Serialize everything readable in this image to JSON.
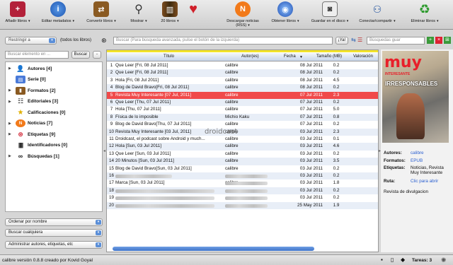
{
  "toolbar": {
    "add_books": "Añadir libros",
    "edit_metadata": "Editar metadatos",
    "convert_books": "Convertir libros",
    "show": "Mostrar",
    "books_count": "20 libros",
    "download_news": "Descargar noticias (RSS)",
    "get_books": "Obtener libros",
    "save_to_disk": "Guardar en el disco",
    "connect_share": "Conectar/compartir",
    "remove_books": "Eliminar libros"
  },
  "search": {
    "restrict_label": "Restringir a",
    "all_books": "(todos los libros)",
    "placeholder": "Buscar (Para búsqueda avanzada, pulse el botón de la izquierda)",
    "go_button": "¡Ya!",
    "saved_searches_placeholder": "Búsquedas guar"
  },
  "tag_browser": {
    "find_placeholder": "Buscar elemento en ...",
    "find_button": "Buscar",
    "collapse_button": "-",
    "items": [
      {
        "label": "Autores [4]",
        "icon": "person-icon"
      },
      {
        "label": "Serie [0]",
        "icon": "series-icon"
      },
      {
        "label": "Formatos [2]",
        "icon": "book-icon"
      },
      {
        "label": "Editoriales [3]",
        "icon": "publisher-icon"
      },
      {
        "label": "Calificaciones [0]",
        "icon": "star-icon"
      },
      {
        "label": "Noticias [7]",
        "icon": "news-icon"
      },
      {
        "label": "Etiquetas [9]",
        "icon": "tag-icon"
      },
      {
        "label": "Identificadores [0]",
        "icon": "barcode-icon"
      },
      {
        "label": "Búsquedas [1]",
        "icon": "binoculars-icon"
      }
    ],
    "sort_by": "Ordenar por nombre",
    "match": "Buscar cualquiera",
    "manage": "Administrar autores, etiquetas, etc"
  },
  "table": {
    "headers": {
      "title": "Título",
      "author": "Autor(es)",
      "date": "Fecha",
      "size": "Tamaño (MB)",
      "rating": "Valoración"
    },
    "rows": [
      {
        "n": "1",
        "title": "Que Leer [Fri, 08 Jul 2011]",
        "author": "calibre",
        "date": "08 Jul 2011",
        "size": "0.2"
      },
      {
        "n": "2",
        "title": "Que Leer [Fri, 08 Jul 2011]",
        "author": "calibre",
        "date": "08 Jul 2011",
        "size": "0.2"
      },
      {
        "n": "3",
        "title": "Hola [Fri, 08 Jul 2011]",
        "author": "calibre",
        "date": "08 Jul 2011",
        "size": "4.5"
      },
      {
        "n": "4",
        "title": "Blog de David Bravo[Fri, 08 Jul 2011]",
        "author": "calibre",
        "date": "08 Jul 2011",
        "size": "0.2"
      },
      {
        "n": "5",
        "title": "Revista Muy Interesante [07 Jul, 2011]",
        "author": "calibre",
        "date": "07 Jul 2011",
        "size": "2.3"
      },
      {
        "n": "6",
        "title": "Que Leer [Thu, 07 Jul 2011]",
        "author": "calibre",
        "date": "07 Jul 2011",
        "size": "0.2"
      },
      {
        "n": "7",
        "title": "Hola [Thu, 07 Jul 2011]",
        "author": "calibre",
        "date": "07 Jul 2011",
        "size": "5.0"
      },
      {
        "n": "8",
        "title": "Física de lo imposible",
        "author": "Michio Kaku",
        "date": "07 Jul 2011",
        "size": "0.8"
      },
      {
        "n": "9",
        "title": "Blog de David Bravo[Thu, 07 Jul 2011]",
        "author": "calibre",
        "date": "07 Jul 2011",
        "size": "0.2"
      },
      {
        "n": "10",
        "title": "Revista Muy Interesante [03 Jul, 2011]",
        "author": "calibre",
        "date": "03 Jul 2011",
        "size": "2.3"
      },
      {
        "n": "11",
        "title": "Droidcast, el podcast sobre Android y much...",
        "author": "calibre",
        "date": "03 Jul 2011",
        "size": "0.1"
      },
      {
        "n": "12",
        "title": "Hola [Sun, 03 Jul 2011]",
        "author": "calibre",
        "date": "03 Jul 2011",
        "size": "4.6"
      },
      {
        "n": "13",
        "title": "Que Leer [Sun, 03 Jul 2011]",
        "author": "calibre",
        "date": "03 Jul 2011",
        "size": "0.2"
      },
      {
        "n": "14",
        "title": "20 Minutos [Sun, 03 Jul 2011]",
        "author": "calibre",
        "date": "03 Jul 2011",
        "size": "3.5"
      },
      {
        "n": "15",
        "title": "Blog de David Bravo[Sun, 03 Jul 2011]",
        "author": "calibre",
        "date": "03 Jul 2011",
        "size": "0.2"
      },
      {
        "n": "16",
        "title": "",
        "author": "",
        "date": "03 Jul 2011",
        "size": "0.2"
      },
      {
        "n": "17",
        "title": "Marca [Sun, 03 Jul 2011]",
        "author": "calibre",
        "date": "03 Jul 2011",
        "size": "1.8"
      },
      {
        "n": "18",
        "title": "",
        "author": "",
        "date": "03 Jul 2011",
        "size": "0.2"
      },
      {
        "n": "19",
        "title": "",
        "author": "",
        "date": "03 Jul 2011",
        "size": "0.2"
      },
      {
        "n": "20",
        "title": "",
        "author": "",
        "date": "25 May 2011",
        "size": "1.9"
      }
    ],
    "watermark": "droidcast"
  },
  "details": {
    "cover_title": "muy",
    "cover_subtitle": "INTERESANTE",
    "cover_headline": "IRRESPONSABLES",
    "authors_label": "Autores:",
    "authors_value": "calibre",
    "formats_label": "Formatos:",
    "formats_value": "EPUB",
    "tags_label": "Etiquetas:",
    "tags_value": "Noticias, Revista Muy Interesante",
    "path_label": "Ruta:",
    "path_value": "Clic para abrir",
    "comment": "Revista de divulgacion"
  },
  "status": {
    "version": "calibre versión 0.8.8 creado por Kovid Goyal",
    "jobs": "Tareas: 3"
  },
  "colors": {
    "selected_row": "#f04a4a",
    "alt_row": "#e8eef7",
    "accent": "#3d72c8"
  }
}
